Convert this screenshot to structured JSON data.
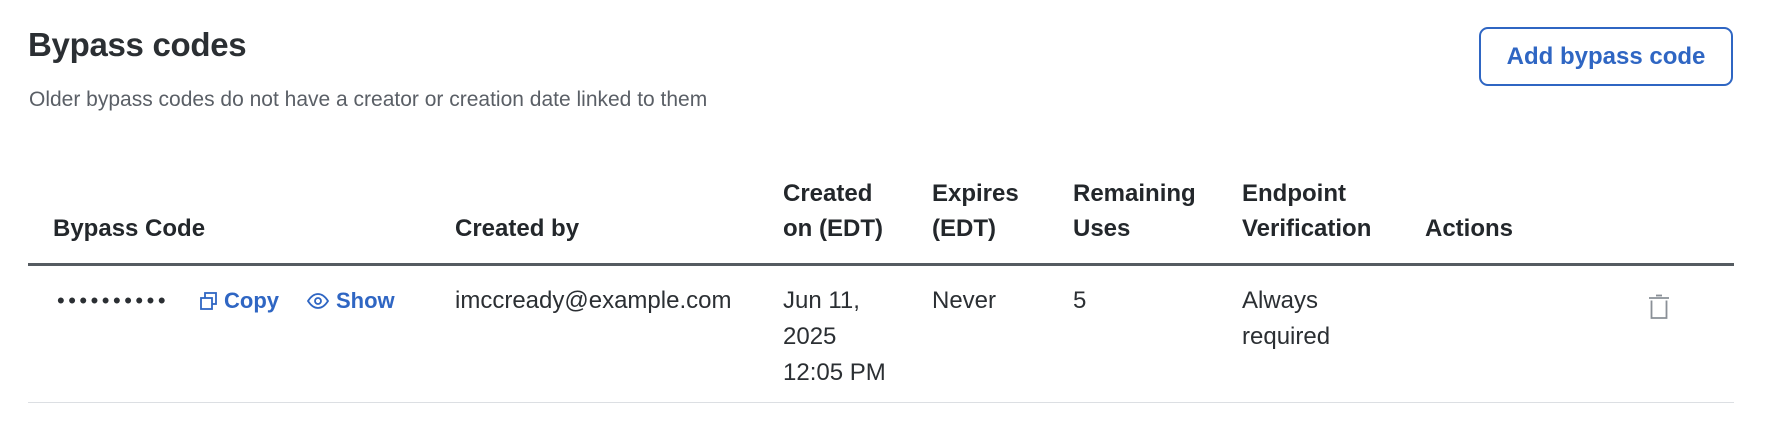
{
  "header": {
    "title": "Bypass codes",
    "subtitle": "Older bypass codes do not have a creator or creation date linked to them",
    "add_button_label": "Add bypass code"
  },
  "table": {
    "columns": [
      {
        "line1": "",
        "line2": "Bypass Code"
      },
      {
        "line1": "",
        "line2": "Created by"
      },
      {
        "line1": "Created",
        "line2": "on (EDT)"
      },
      {
        "line1": "Expires",
        "line2": "(EDT)"
      },
      {
        "line1": "Remaining",
        "line2": "Uses"
      },
      {
        "line1": "Endpoint",
        "line2": "Verification"
      },
      {
        "line1": "",
        "line2": "Actions"
      }
    ],
    "rows": [
      {
        "code_masked": "••••••••••",
        "copy_label": "Copy",
        "show_label": "Show",
        "created_by": "imccready@example.com",
        "created_on_date": "Jun 11,",
        "created_on_year": "2025",
        "created_on_time": "12:05 PM",
        "expires": "Never",
        "remaining_uses": "5",
        "verification_line1": "Always",
        "verification_line2": "required",
        "delete_icon": "trash-icon"
      }
    ]
  },
  "colors": {
    "accent": "#2f66c3",
    "text": "#2b2f33",
    "muted": "#5a5f66",
    "divider": "#555b61"
  }
}
